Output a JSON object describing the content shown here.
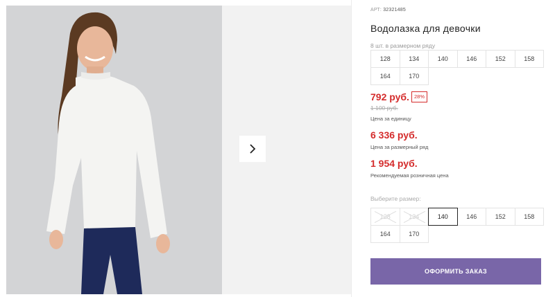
{
  "product": {
    "article_label": "АРТ:",
    "article_value": "32321485",
    "title": "Водолазка для девочки",
    "size_row_note": "8 шт. в размерном ряду",
    "size_row": [
      "128",
      "134",
      "140",
      "146",
      "152",
      "158",
      "164",
      "170"
    ]
  },
  "pricing": {
    "price": "792 руб.",
    "discount": "28%",
    "old_price": "1 100 руб.",
    "unit_label": "Цена за единицу",
    "row_price": "6 336 руб.",
    "row_label": "Цена за размерный ряд",
    "rrp_price": "1 954 руб.",
    "rrp_label": "Рекомендуемая розничная цена"
  },
  "size_select": {
    "label": "Выберите размер:",
    "options": [
      {
        "label": "128",
        "state": "disabled"
      },
      {
        "label": "134",
        "state": "disabled"
      },
      {
        "label": "140",
        "state": "selected"
      },
      {
        "label": "146",
        "state": "available"
      },
      {
        "label": "152",
        "state": "available"
      },
      {
        "label": "158",
        "state": "available"
      },
      {
        "label": "164",
        "state": "available"
      },
      {
        "label": "170",
        "state": "available"
      }
    ]
  },
  "actions": {
    "order_label": "ОФОРМИТЬ ЗАКАЗ"
  },
  "icons": {
    "next": "chevron-right-icon"
  },
  "colors": {
    "price_red": "#d42b2b",
    "button_purple": "#7966a8"
  }
}
